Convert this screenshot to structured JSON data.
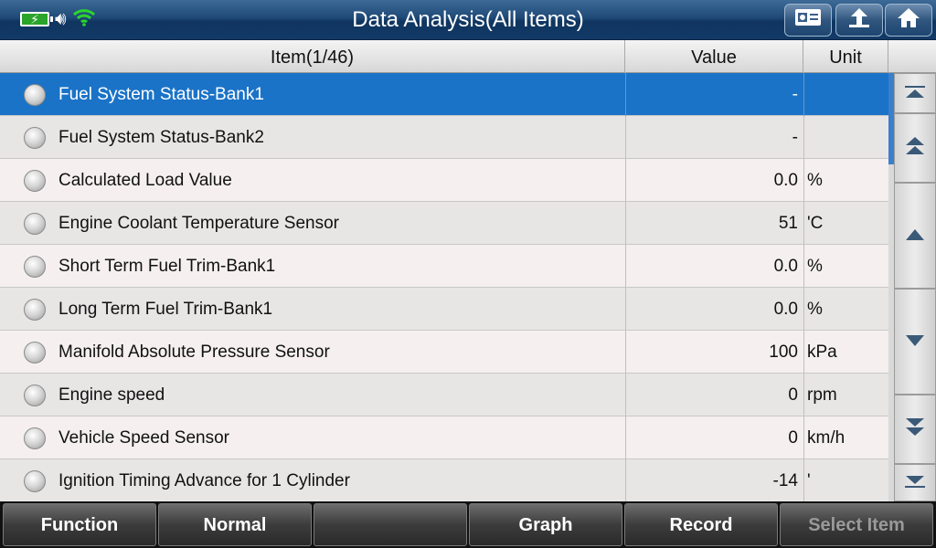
{
  "header": {
    "title": "Data Analysis(All Items)",
    "colors": {
      "bar": "#1f4a78",
      "wifi": "#2bd52b",
      "battery": "#2aa52a"
    }
  },
  "table": {
    "columns": {
      "item": "Item(1/46)",
      "value": "Value",
      "unit": "Unit"
    },
    "selected_color": "#1a73c7",
    "rows": [
      {
        "name": "Fuel System Status-Bank1",
        "value": "-",
        "unit": ""
      },
      {
        "name": "Fuel System Status-Bank2",
        "value": "-",
        "unit": ""
      },
      {
        "name": "Calculated Load Value",
        "value": "0.0",
        "unit": "%"
      },
      {
        "name": "Engine Coolant Temperature Sensor",
        "value": "51",
        "unit": "'C"
      },
      {
        "name": "Short Term Fuel Trim-Bank1",
        "value": "0.0",
        "unit": "%"
      },
      {
        "name": "Long Term Fuel Trim-Bank1",
        "value": "0.0",
        "unit": "%"
      },
      {
        "name": "Manifold Absolute Pressure Sensor",
        "value": "100",
        "unit": "kPa"
      },
      {
        "name": "Engine speed",
        "value": "0",
        "unit": "rpm"
      },
      {
        "name": "Vehicle Speed Sensor",
        "value": "0",
        "unit": "km/h"
      },
      {
        "name": "Ignition Timing Advance for 1 Cylinder",
        "value": "-14",
        "unit": "'"
      }
    ]
  },
  "toolbar": {
    "function_label": "Function",
    "normal_label": "Normal",
    "empty_label": "",
    "graph_label": "Graph",
    "record_label": "Record",
    "select_item_label": "Select Item"
  }
}
